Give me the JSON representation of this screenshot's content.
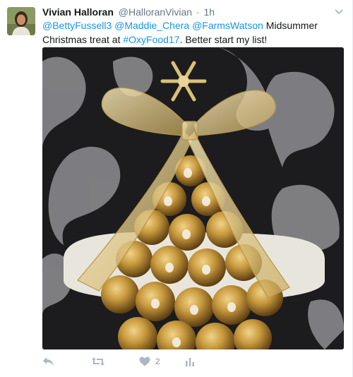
{
  "tweet": {
    "fullname": "Vivian Halloran",
    "username": "@HalloranVivian",
    "separator": "·",
    "time": "1h",
    "mention_1": "@BettyFussell3",
    "mention_2": "@Maddie_Chera",
    "mention_3": "@FarmsWatson",
    "text_1": "Midsummer Christmas treat at",
    "hashtag": "#OxyFood17",
    "text_2": ". Better start my list!",
    "likes_count": "2"
  },
  "icons": {
    "caret": "chevron-down-icon",
    "reply": "reply-icon",
    "retweet": "retweet-icon",
    "like": "heart-icon",
    "analytics": "analytics-icon"
  },
  "colors": {
    "link": "#1b95e0",
    "muted": "#657786",
    "action": "#aab8c2"
  }
}
